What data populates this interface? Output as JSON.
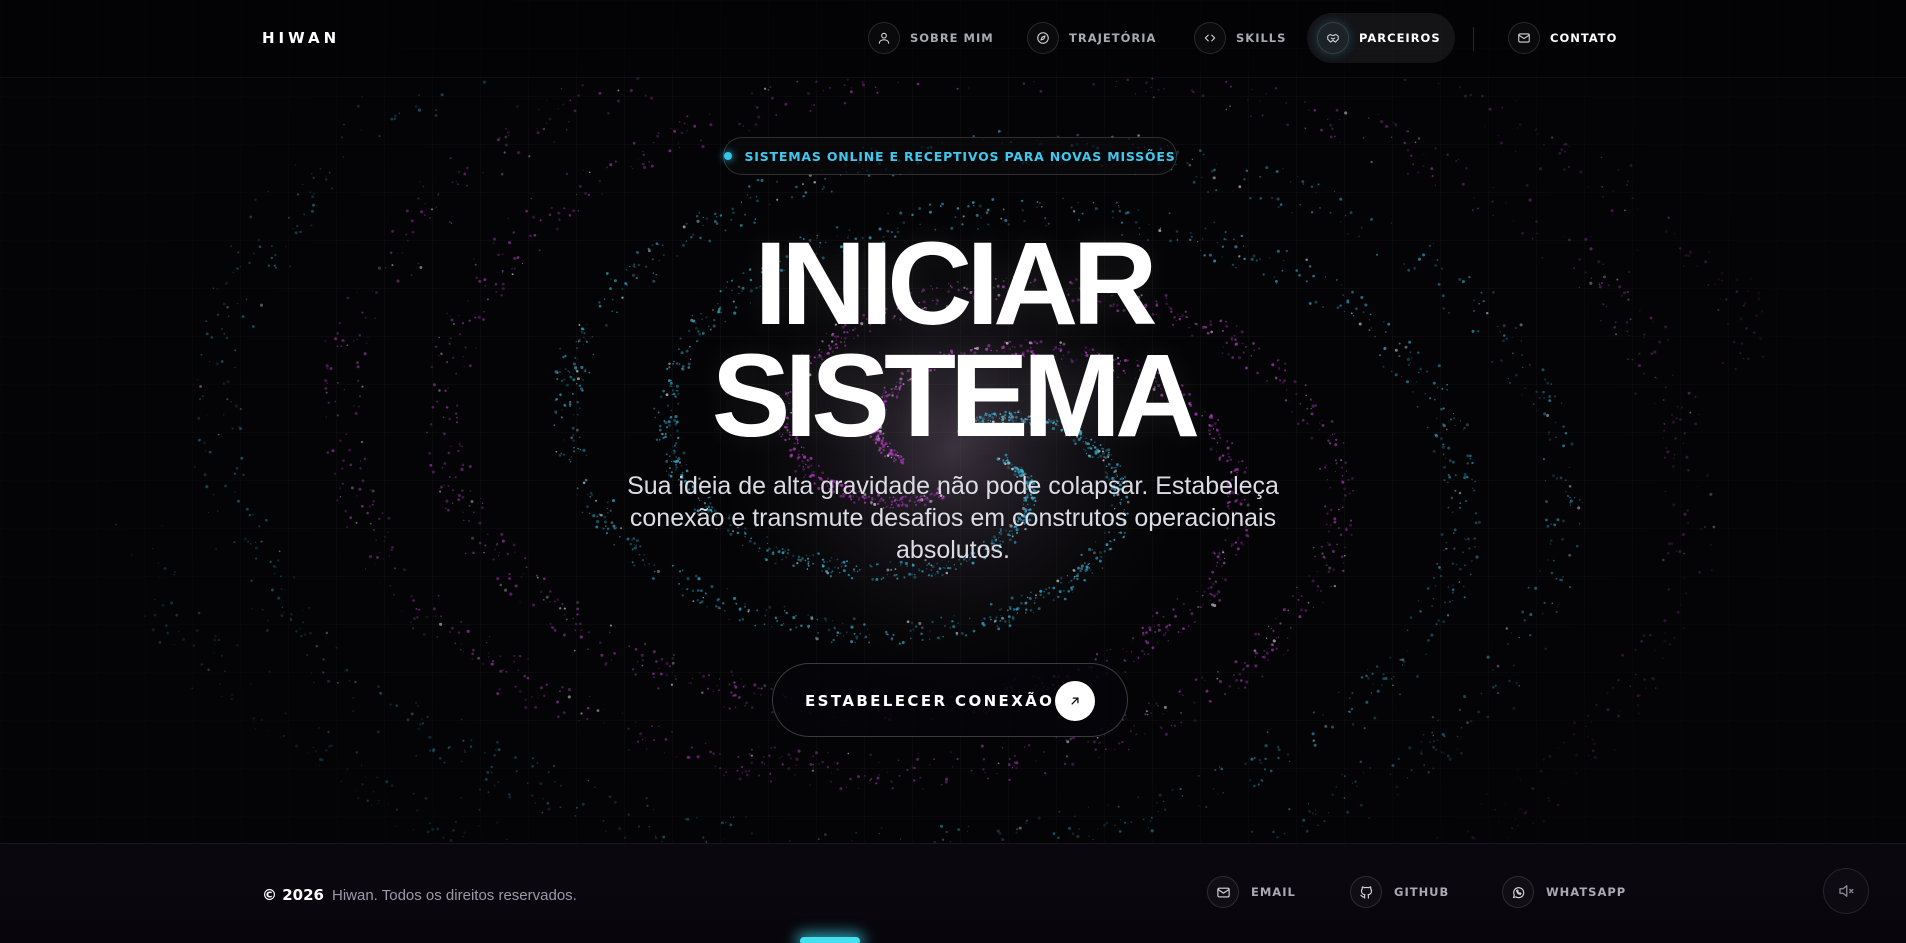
{
  "brand": {
    "logo": "HIWAN"
  },
  "nav": {
    "items": [
      {
        "label": "SOBRE MIM",
        "icon": "user-icon"
      },
      {
        "label": "TRAJETÓRIA",
        "icon": "compass-icon"
      },
      {
        "label": "SKILLS",
        "icon": "code-icon"
      },
      {
        "label": "PARCEIROS",
        "icon": "handshake-icon",
        "active": true
      },
      {
        "label": "CONTATO",
        "icon": "mail-icon"
      }
    ]
  },
  "hero": {
    "status": "SISTEMAS ONLINE E RECEPTIVOS PARA NOVAS MISSÕES",
    "headline_line1": "INICIAR",
    "headline_line2": "SISTEMA",
    "subtitle": "Sua ideia de alta gravidade não pode colapsar. Estabeleça conexão e transmute desafios em construtos operacionais absolutos.",
    "cta_label": "ESTABELECER CONEXÃO",
    "cta_icon": "arrow-up-right-icon"
  },
  "footer": {
    "year": "© 2026",
    "rights": "Hiwan. Todos os direitos reservados.",
    "links": [
      {
        "label": "EMAIL",
        "icon": "mail-icon"
      },
      {
        "label": "GITHUB",
        "icon": "github-icon"
      },
      {
        "label": "WHATSAPP",
        "icon": "whatsapp-icon"
      }
    ],
    "sound_icon": "volume-mute-icon"
  },
  "colors": {
    "accent_cyan": "#35c4ea",
    "accent_magenta": "#c040d0",
    "background": "#040406"
  }
}
